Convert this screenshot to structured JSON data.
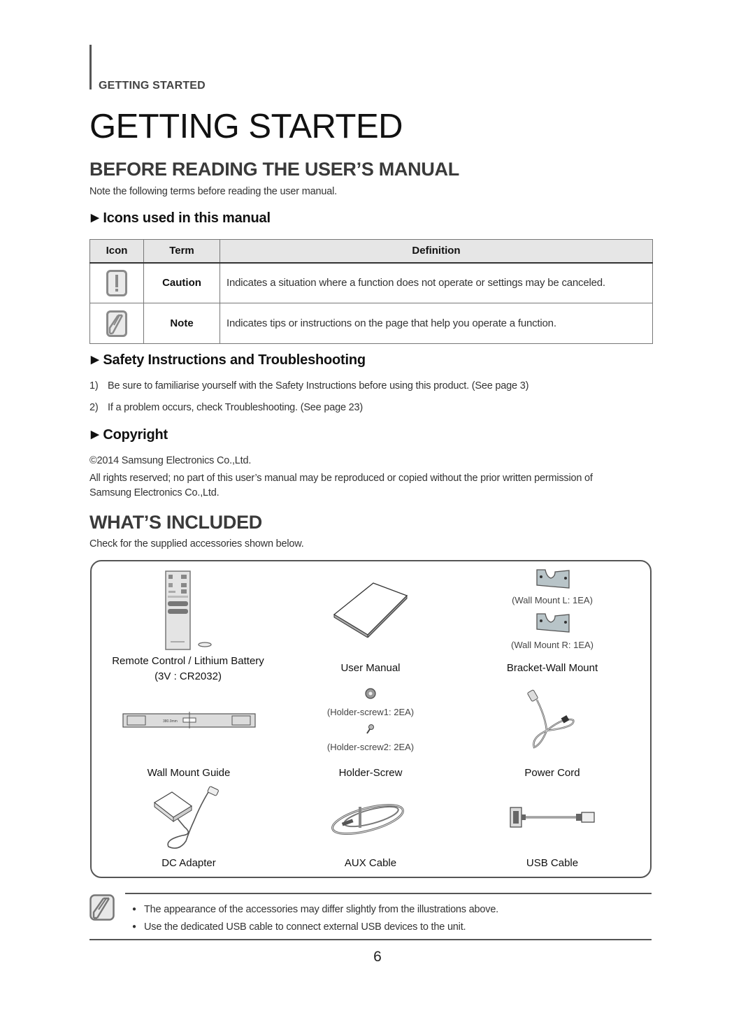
{
  "running_head": "GETTING STARTED",
  "page_title": "GETTING STARTED",
  "before_reading": {
    "heading": "BEFORE READING THE USER’S MANUAL",
    "intro": "Note the following terms before reading the user manual.",
    "icons_section": {
      "heading": "Icons used in this manual",
      "table": {
        "headers": [
          "Icon",
          "Term",
          "Definition"
        ],
        "rows": [
          {
            "icon": "caution-icon",
            "term": "Caution",
            "definition": "Indicates a situation where a function does not operate or settings may be canceled."
          },
          {
            "icon": "note-icon",
            "term": "Note",
            "definition": "Indicates tips or instructions on the page that help you operate a function."
          }
        ]
      }
    },
    "safety_section": {
      "heading": "Safety Instructions and Troubleshooting",
      "items": [
        {
          "num": "1)",
          "text": "Be sure to familiarise yourself with the Safety Instructions before using this product. (See page 3)"
        },
        {
          "num": "2)",
          "text": "If a problem occurs, check Troubleshooting. (See page 23)"
        }
      ]
    },
    "copyright_section": {
      "heading": "Copyright",
      "line1": "©2014 Samsung Electronics Co.,Ltd.",
      "line2": "All rights reserved; no part of this user’s manual may be reproduced or copied without the prior written permission of",
      "line3": "Samsung Electronics Co.,Ltd."
    }
  },
  "whats_included": {
    "heading": "WHAT’S INCLUDED",
    "intro": "Check for the supplied accessories shown below.",
    "accessories": {
      "remote": {
        "label_line1": "Remote Control / Lithium Battery",
        "label_line2": "(3V : CR2032)",
        "icon": "remote-control-icon"
      },
      "manual": {
        "label": "User Manual",
        "icon": "user-manual-icon"
      },
      "bracket": {
        "label": "Bracket-Wall Mount",
        "sub_l": "(Wall Mount L: 1EA)",
        "sub_r": "(Wall Mount R: 1EA)",
        "icon": "wall-bracket-icon"
      },
      "guide": {
        "label": "Wall Mount Guide",
        "icon": "wall-mount-guide-icon",
        "dimension": "380.0mm"
      },
      "screw": {
        "label": "Holder-Screw",
        "sub1": "(Holder-screw1: 2EA)",
        "sub2": "(Holder-screw2: 2EA)",
        "icon": "screw-icon"
      },
      "power": {
        "label": "Power Cord",
        "icon": "power-cord-icon"
      },
      "dc": {
        "label": "DC Adapter",
        "icon": "dc-adapter-icon"
      },
      "aux": {
        "label": "AUX Cable",
        "icon": "aux-cable-icon"
      },
      "usb": {
        "label": "USB Cable",
        "icon": "usb-cable-icon"
      }
    }
  },
  "notes": [
    "The appearance of the accessories may differ slightly from the illustrations above.",
    "Use the dedicated USB cable to connect external USB devices to the unit."
  ],
  "page_number": "6"
}
